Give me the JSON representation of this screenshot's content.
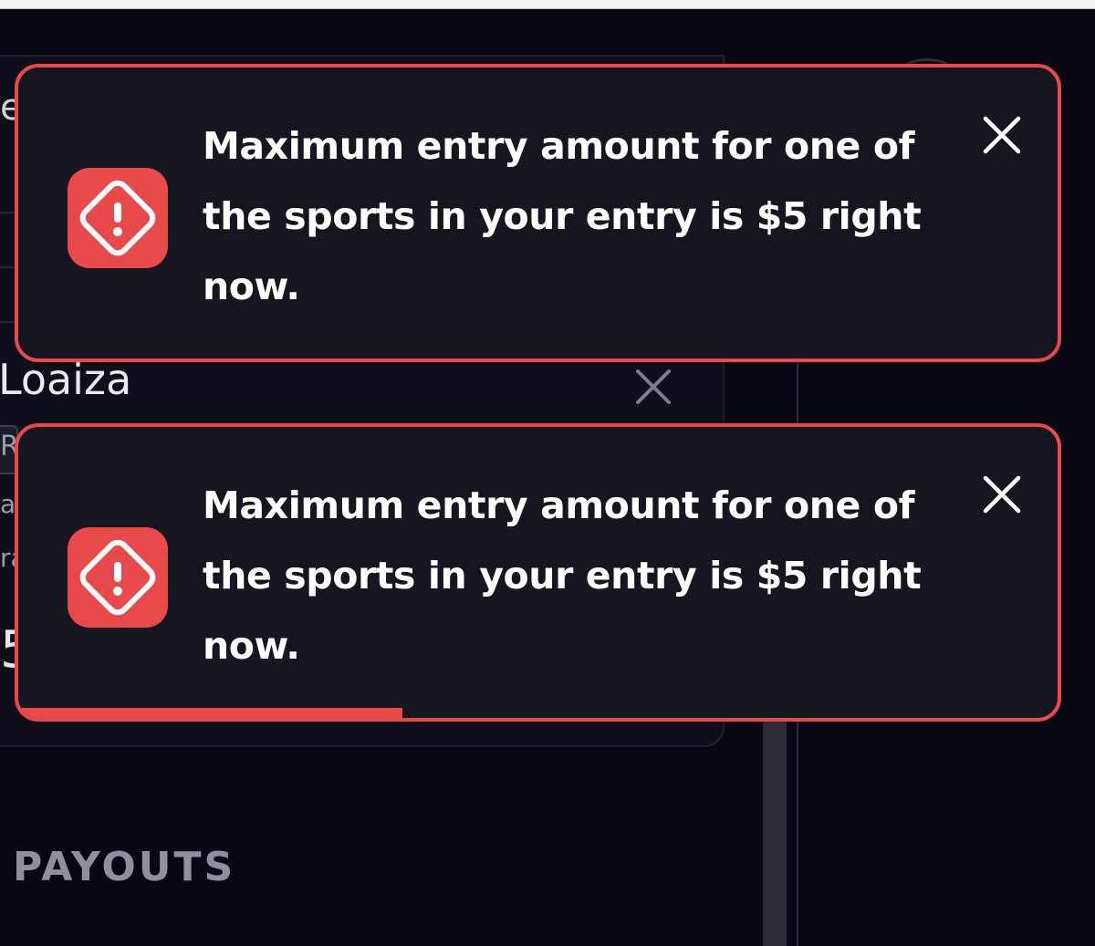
{
  "background": {
    "player_name": "Loaiza",
    "edge_chars": [
      "e",
      "R",
      "a",
      "ra",
      "5"
    ],
    "section_heading": "PAYOUTS"
  },
  "toasts": [
    {
      "icon": "alert-octagon-icon",
      "message": "Maximum entry amount for one of the sports in your entry is $5 right now.",
      "close_icon": "close-icon",
      "progress": 0
    },
    {
      "icon": "alert-octagon-icon",
      "message": "Maximum entry amount for one of the sports in your entry is $5 right now.",
      "close_icon": "close-icon",
      "progress": 0.37
    }
  ],
  "colors": {
    "accent": "#e9494b",
    "toast_bg": "#15161f",
    "page_bg": "#070812"
  }
}
